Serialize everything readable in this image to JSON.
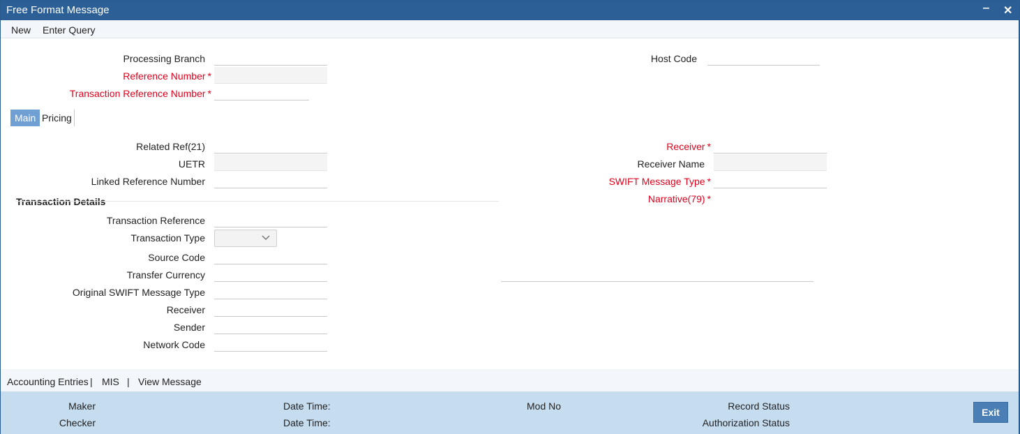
{
  "window": {
    "title": "Free Format Message",
    "minimize_glyph": "‒",
    "close_glyph": "✕"
  },
  "menu": {
    "new": "New",
    "enter_query": "Enter Query"
  },
  "header": {
    "processing_branch_label": "Processing Branch",
    "processing_branch_value": "",
    "reference_number_label": "Reference Number",
    "reference_number_value": "",
    "txn_reference_number_label": "Transaction Reference Number",
    "txn_reference_number_value": "",
    "host_code_label": "Host Code",
    "host_code_value": "",
    "required_marker": "*"
  },
  "tabs": {
    "main": "Main",
    "pricing": "Pricing"
  },
  "main": {
    "related_ref_label": "Related Ref(21)",
    "related_ref_value": "",
    "uetr_label": "UETR",
    "uetr_value": "",
    "linked_reference_label": "Linked Reference Number",
    "linked_reference_value": "",
    "receiver_label": "Receiver",
    "receiver_value": "",
    "receiver_name_label": "Receiver Name",
    "receiver_name_value": "",
    "swift_message_type_label": "SWIFT Message Type",
    "swift_message_type_value": "",
    "narrative_label": "Narrative(79)",
    "narrative_value": ""
  },
  "transaction_details": {
    "section_title": "Transaction Details",
    "transaction_reference_label": "Transaction Reference",
    "transaction_reference_value": "",
    "transaction_type_label": "Transaction Type",
    "transaction_type_value": "",
    "source_code_label": "Source Code",
    "source_code_value": "",
    "transfer_currency_label": "Transfer Currency",
    "transfer_currency_value": "",
    "original_swift_label": "Original SWIFT Message Type",
    "original_swift_value": "",
    "receiver_label": "Receiver",
    "receiver_value": "",
    "sender_label": "Sender",
    "sender_value": "",
    "network_code_label": "Network Code",
    "network_code_value": ""
  },
  "footer_links": {
    "accounting_entries": "Accounting Entries",
    "mis": "MIS",
    "view_message": "View Message",
    "separator": "|"
  },
  "status": {
    "maker": "Maker",
    "checker": "Checker",
    "date_time_1": "Date Time:",
    "date_time_2": "Date Time:",
    "mod_no": "Mod No",
    "record_status": "Record Status",
    "authorization_status": "Authorization Status",
    "exit": "Exit"
  },
  "colors": {
    "title_bar": "#2c5f95",
    "required_label": "#e0001b",
    "active_tab": "#6f9fd3",
    "status_bar": "#c6dcef",
    "exit_button": "#4a7fb6"
  }
}
